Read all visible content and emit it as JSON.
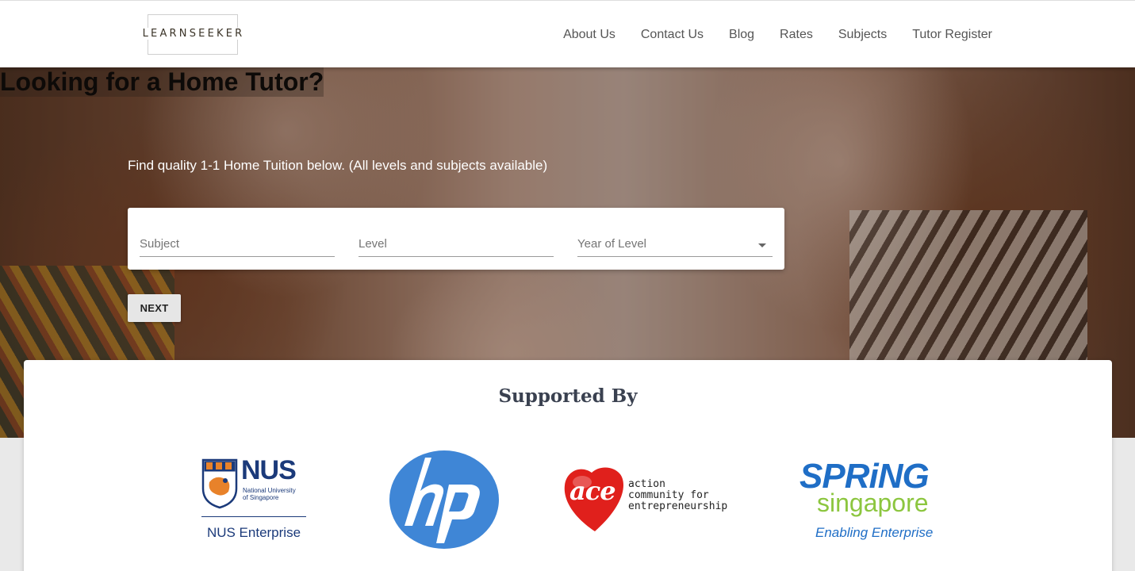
{
  "header": {
    "logo_text": "LEARNSEEKER",
    "nav": [
      "About Us",
      "Contact Us",
      "Blog",
      "Rates",
      "Subjects",
      "Tutor Register"
    ]
  },
  "hero": {
    "title": "Looking for a Home Tutor?",
    "subtitle": "Find quality 1-1 Home Tuition below. (All levels and subjects available)",
    "fields": {
      "subject_label": "Subject",
      "level_label": "Level",
      "year_label": "Year of Level"
    },
    "next_label": "NEXT"
  },
  "support": {
    "heading": "Supported By",
    "nus": {
      "name": "NUS",
      "line1": "National University",
      "line2": "of Singapore",
      "footer": "NUS Enterprise"
    },
    "hp": {
      "name": "hp"
    },
    "ace": {
      "name": "ace",
      "line1": "action",
      "line2": "community for",
      "line3": "entrepreneurship"
    },
    "spring": {
      "line1": "SPRiNG",
      "line2": "singapore",
      "line3": "Enabling Enterprise"
    }
  },
  "colors": {
    "nus_blue": "#1b3a7a",
    "nus_orange": "#e8822a",
    "hp_blue": "#3f86d6",
    "ace_red": "#e0201c",
    "spring_blue": "#1f6ec6",
    "spring_green": "#8cc63f"
  }
}
